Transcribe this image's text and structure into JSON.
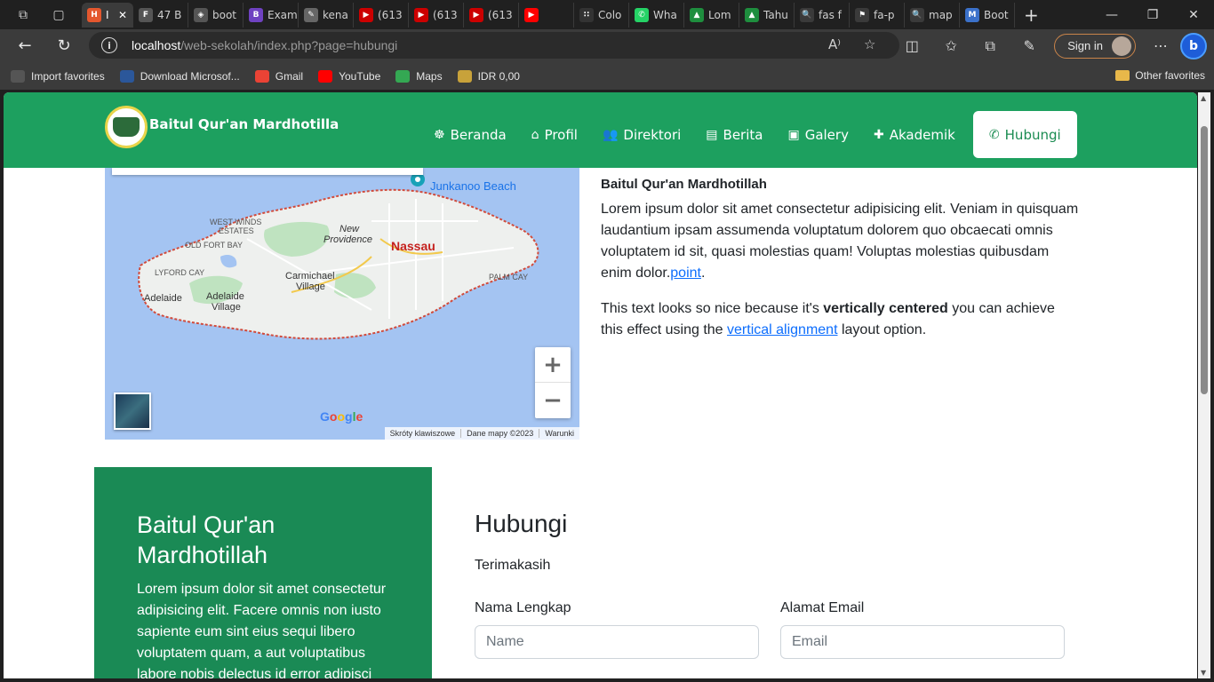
{
  "browser": {
    "tabs": [
      {
        "label": "I",
        "color": "#e4572e",
        "glyph": "H"
      },
      {
        "label": "47 B",
        "color": "#555555",
        "glyph": "F"
      },
      {
        "label": "boot",
        "color": "#555555",
        "glyph": "◈"
      },
      {
        "label": "Exam",
        "color": "#6f42c1",
        "glyph": "B"
      },
      {
        "label": "kena",
        "color": "#666666",
        "glyph": "✎"
      },
      {
        "label": "(613",
        "color": "#cc0000",
        "glyph": "▶"
      },
      {
        "label": "(613",
        "color": "#cc0000",
        "glyph": "▶"
      },
      {
        "label": "(613",
        "color": "#cc0000",
        "glyph": "▶"
      },
      {
        "label": "",
        "color": "#ff0000",
        "glyph": "▶"
      },
      {
        "label": "Colo",
        "color": "#333333",
        "glyph": "∷"
      },
      {
        "label": "Wha",
        "color": "#25d366",
        "glyph": "✆"
      },
      {
        "label": "Lom",
        "color": "#1e8e3e",
        "glyph": "▲"
      },
      {
        "label": "Tahu",
        "color": "#1e8e3e",
        "glyph": "▲"
      },
      {
        "label": "fas f",
        "color": "#3a3a3a",
        "glyph": "🔍"
      },
      {
        "label": "fa-p",
        "color": "#3a3a3a",
        "glyph": "⚑"
      },
      {
        "label": "map",
        "color": "#3a3a3a",
        "glyph": "🔍"
      },
      {
        "label": "Boot",
        "color": "#3b71ca",
        "glyph": "M"
      }
    ],
    "url_host": "localhost",
    "url_path": "/web-sekolah/index.php?page=hubungi",
    "sign_in": "Sign in",
    "bookmarks": [
      {
        "label": "Import favorites",
        "color": "#555555"
      },
      {
        "label": "Download Microsof...",
        "color": "#2b579a"
      },
      {
        "label": "Gmail",
        "color": "#ea4335"
      },
      {
        "label": "YouTube",
        "color": "#ff0000"
      },
      {
        "label": "Maps",
        "color": "#34a853"
      },
      {
        "label": "IDR 0,00",
        "color": "#c8a23a"
      }
    ],
    "other_favorites": "Other favorites"
  },
  "site": {
    "brand": "Baitul Qur'an Mardhotilla",
    "menu": [
      {
        "label": "Beranda",
        "icon": "☸"
      },
      {
        "label": "Profil",
        "icon": "⌂"
      },
      {
        "label": "Direktori",
        "icon": "👥"
      },
      {
        "label": "Berita",
        "icon": "▤"
      },
      {
        "label": "Galery",
        "icon": "▣"
      },
      {
        "label": "Akademik",
        "icon": "✚"
      },
      {
        "label": "Hubungi",
        "icon": "✆"
      }
    ],
    "active_menu": "Hubungi"
  },
  "map": {
    "labels": {
      "junkanoo": "Junkanoo Beach",
      "west_winds": "WEST WINDS",
      "estates": "ESTATES",
      "new_providence_1": "New",
      "new_providence_2": "Providence",
      "nassau": "Nassau",
      "old_fort_bay": "OLD FORT BAY",
      "lyford_cay": "LYFORD CAY",
      "carmichael_1": "Carmichael",
      "carmichael_2": "Village",
      "palm_cay": "PALM CAY",
      "adelaide": "Adelaide",
      "adelaide_village_1": "Adelaide",
      "adelaide_village_2": "Village"
    },
    "google": "Google",
    "attribution": [
      "Skróty klawiszowe",
      "Dane mapy ©2023",
      "Warunki"
    ]
  },
  "about": {
    "title": "Baitul Qur'an Mardhotillah",
    "para1": "Lorem ipsum dolor sit amet consectetur adipisicing elit. Veniam in quisquam laudantium ipsam assumenda voluptatum dolorem quo obcaecati omnis voluptatem id sit, quasi molestias quam! Voluptas molestias quibusdam enim dolor.",
    "para1_link": "point",
    "para2_a": "This text looks so nice because it's ",
    "para2_bold": "vertically centered",
    "para2_b": " you can achieve this effect using the ",
    "para2_link": "vertical alignment",
    "para2_c": " layout option."
  },
  "contact_info": {
    "title": "Baitul Qur'an Mardhotillah",
    "text": "Lorem ipsum dolor sit amet consectetur adipisicing elit. Facere omnis non iusto sapiente eum sint eius sequi libero voluptatem quam, a aut voluptatibus labore nobis delectus id error adipisci"
  },
  "form": {
    "title": "Hubungi",
    "thanks": "Terimakasih",
    "name_label": "Nama Lengkap",
    "name_placeholder": "Name",
    "email_label": "Alamat Email",
    "email_placeholder": "Email"
  }
}
